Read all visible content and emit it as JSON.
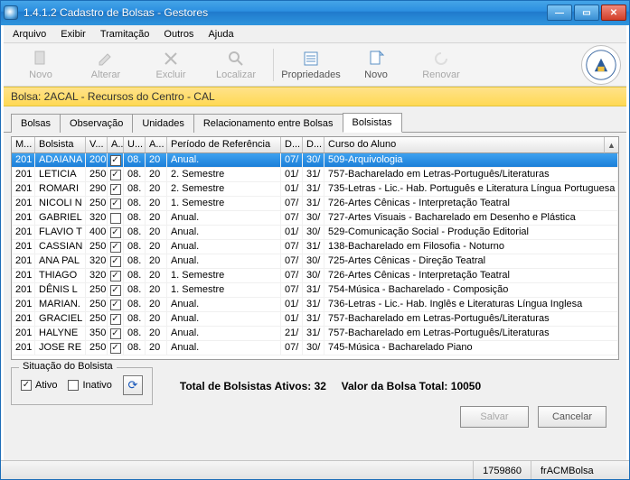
{
  "window": {
    "title": "1.4.1.2 Cadastro de Bolsas - Gestores"
  },
  "menu": {
    "items": [
      "Arquivo",
      "Exibir",
      "Tramitação",
      "Outros",
      "Ajuda"
    ]
  },
  "toolbar": {
    "novo": "Novo",
    "alterar": "Alterar",
    "excluir": "Excluir",
    "localizar": "Localizar",
    "propriedades": "Propriedades",
    "novo2": "Novo",
    "renovar": "Renovar"
  },
  "bolsa_header": "Bolsa: 2ACAL - Recursos do Centro - CAL",
  "tabs": {
    "items": [
      "Bolsas",
      "Observação",
      "Unidades",
      "Relacionamento entre Bolsas",
      "Bolsistas"
    ],
    "active_index": 4
  },
  "table": {
    "headers": [
      "M...",
      "Bolsista",
      "V...",
      "A...",
      "U...",
      "A...",
      "Período de Referência",
      "D...",
      "D...",
      "Curso do Aluno"
    ],
    "rows": [
      {
        "m": "201",
        "b": "ADAIANA",
        "v": "200",
        "a1": true,
        "u": "08.",
        "a2": "20",
        "per": "Anual.",
        "d1": "07/",
        "d2": "30/",
        "curso": "509-Arquivologia",
        "sel": true
      },
      {
        "m": "201",
        "b": "LETICIA",
        "v": "250",
        "a1": true,
        "u": "08.",
        "a2": "20",
        "per": "2. Semestre",
        "d1": "01/",
        "d2": "31/",
        "curso": "757-Bacharelado em Letras-Português/Literaturas"
      },
      {
        "m": "201",
        "b": "ROMARI",
        "v": "290",
        "a1": true,
        "u": "08.",
        "a2": "20",
        "per": "2. Semestre",
        "d1": "01/",
        "d2": "31/",
        "curso": "735-Letras - Lic.- Hab. Português e Literatura Língua Portuguesa"
      },
      {
        "m": "201",
        "b": "NICOLI N",
        "v": "250",
        "a1": true,
        "u": "08.",
        "a2": "20",
        "per": "1. Semestre",
        "d1": "07/",
        "d2": "31/",
        "curso": "726-Artes Cênicas - Interpretação Teatral"
      },
      {
        "m": "201",
        "b": "GABRIEL",
        "v": "320",
        "a1": false,
        "u": "08.",
        "a2": "20",
        "per": "Anual.",
        "d1": "07/",
        "d2": "30/",
        "curso": "727-Artes Visuais - Bacharelado em  Desenho e Plástica"
      },
      {
        "m": "201",
        "b": "FLAVIO T",
        "v": "400",
        "a1": true,
        "u": "08.",
        "a2": "20",
        "per": "Anual.",
        "d1": "01/",
        "d2": "30/",
        "curso": "529-Comunicação Social - Produção Editorial"
      },
      {
        "m": "201",
        "b": "CASSIAN",
        "v": "250",
        "a1": true,
        "u": "08.",
        "a2": "20",
        "per": "Anual.",
        "d1": "07/",
        "d2": "31/",
        "curso": "138-Bacharelado em Filosofia - Noturno"
      },
      {
        "m": "201",
        "b": "ANA PAL",
        "v": "320",
        "a1": true,
        "u": "08.",
        "a2": "20",
        "per": "Anual.",
        "d1": "07/",
        "d2": "30/",
        "curso": "725-Artes Cênicas - Direção Teatral"
      },
      {
        "m": "201",
        "b": "THIAGO",
        "v": "320",
        "a1": true,
        "u": "08.",
        "a2": "20",
        "per": "1. Semestre",
        "d1": "07/",
        "d2": "30/",
        "curso": "726-Artes Cênicas - Interpretação Teatral"
      },
      {
        "m": "201",
        "b": "DÊNIS L",
        "v": "250",
        "a1": true,
        "u": "08.",
        "a2": "20",
        "per": "1. Semestre",
        "d1": "07/",
        "d2": "31/",
        "curso": "754-Música - Bacharelado - Composição"
      },
      {
        "m": "201",
        "b": "MARIAN.",
        "v": "250",
        "a1": true,
        "u": "08.",
        "a2": "20",
        "per": "Anual.",
        "d1": "01/",
        "d2": "31/",
        "curso": "736-Letras - Lic.- Hab. Inglês e Literaturas Língua Inglesa"
      },
      {
        "m": "201",
        "b": "GRACIEL",
        "v": "250",
        "a1": true,
        "u": "08.",
        "a2": "20",
        "per": "Anual.",
        "d1": "01/",
        "d2": "31/",
        "curso": "757-Bacharelado em Letras-Português/Literaturas"
      },
      {
        "m": "201",
        "b": "HALYNE",
        "v": "350",
        "a1": true,
        "u": "08.",
        "a2": "20",
        "per": "Anual.",
        "d1": "21/",
        "d2": "31/",
        "curso": "757-Bacharelado em Letras-Português/Literaturas"
      },
      {
        "m": "201",
        "b": "JOSE RE",
        "v": "250",
        "a1": true,
        "u": "08.",
        "a2": "20",
        "per": "Anual.",
        "d1": "07/",
        "d2": "30/",
        "curso": "745-Música - Bacharelado Piano"
      }
    ]
  },
  "situacao": {
    "legend": "Situação do Bolsista",
    "ativo_label": "Ativo",
    "ativo_checked": true,
    "inativo_label": "Inativo",
    "inativo_checked": false
  },
  "totals": {
    "ativos_label": "Total de Bolsistas Ativos:",
    "ativos_value": "32",
    "valor_label": "Valor da Bolsa Total:",
    "valor_value": "10050"
  },
  "buttons": {
    "salvar": "Salvar",
    "cancelar": "Cancelar"
  },
  "statusbar": {
    "left": "1759860",
    "right": "frACMBolsa"
  }
}
